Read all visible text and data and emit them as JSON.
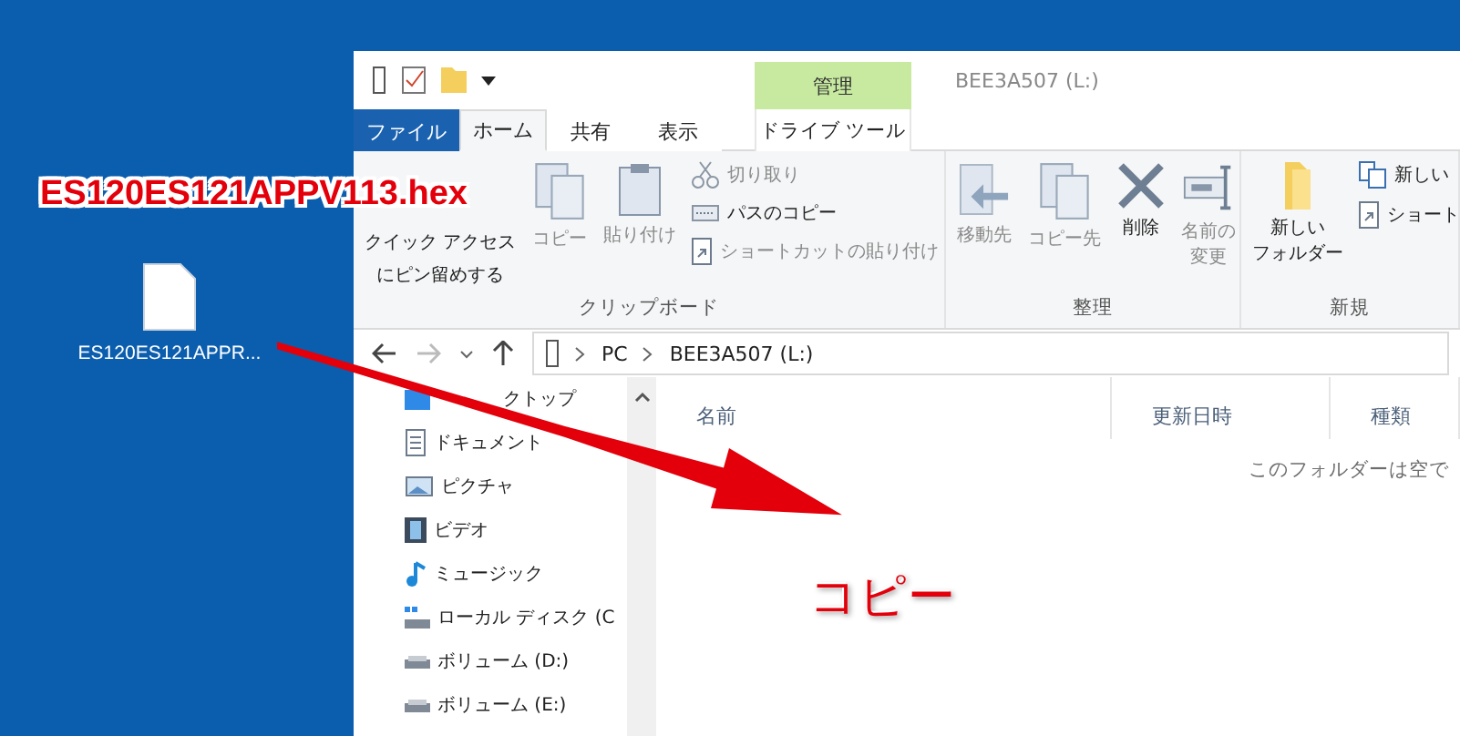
{
  "desktop": {
    "icons": [
      {
        "label": "ES120ES121APPR..."
      }
    ]
  },
  "explorer": {
    "context_tab": "管理",
    "title": "BEE3A507 (L:)",
    "tabs": [
      {
        "label": "ファイル",
        "kind": "file",
        "selected": false
      },
      {
        "label": "ホーム",
        "kind": "normal",
        "selected": true
      },
      {
        "label": "共有",
        "kind": "normal",
        "selected": false
      },
      {
        "label": "表示",
        "kind": "normal",
        "selected": false
      },
      {
        "label": "ドライブ ツール",
        "kind": "context",
        "selected": false
      }
    ],
    "ribbon": [
      {
        "label": "クリップボード",
        "large": [
          {
            "lines": [
              "クイック アクセス",
              "にピン留めする"
            ],
            "kind": "pin",
            "disabled": false
          },
          {
            "lines": [
              "コピー"
            ],
            "kind": "copy",
            "disabled": true
          },
          {
            "lines": [
              "貼り付け"
            ],
            "kind": "paste",
            "disabled": true
          }
        ],
        "small": [
          {
            "label": "切り取り",
            "kind": "cut",
            "disabled": true
          },
          {
            "label": "パスのコピー",
            "kind": "path",
            "disabled": false
          },
          {
            "label": "ショートカットの貼り付け",
            "kind": "shortcut",
            "disabled": true
          }
        ]
      },
      {
        "label": "整理",
        "large": [
          {
            "lines": [
              "移動先"
            ],
            "kind": "move",
            "disabled": true
          },
          {
            "lines": [
              "コピー先"
            ],
            "kind": "copy",
            "disabled": true
          },
          {
            "lines": [
              "削除"
            ],
            "kind": "delete",
            "disabled": false
          },
          {
            "lines": [
              "名前の",
              "変更"
            ],
            "kind": "rename",
            "disabled": true
          }
        ]
      },
      {
        "label": "新規",
        "large": [
          {
            "lines": [
              "新しい",
              "フォルダー"
            ],
            "kind": "folder",
            "disabled": false
          }
        ],
        "small": [
          {
            "label": "新しい",
            "kind": "newitem"
          },
          {
            "label": "ショート",
            "kind": "shortcut"
          }
        ]
      }
    ],
    "address": {
      "crumbs": [
        "PC",
        "BEE3A507 (L:)"
      ]
    },
    "nav_pane": {
      "items": [
        {
          "label": "クトップ",
          "kind": "desktop"
        },
        {
          "label": "ドキュメント",
          "kind": "document"
        },
        {
          "label": "ピクチャ",
          "kind": "picture"
        },
        {
          "label": "ビデオ",
          "kind": "video"
        },
        {
          "label": "ミュージック",
          "kind": "music"
        },
        {
          "label": "ローカル ディスク (C",
          "kind": "disk"
        },
        {
          "label": "ボリューム (D:)",
          "kind": "drive"
        },
        {
          "label": "ボリューム (E:)",
          "kind": "drive"
        }
      ]
    },
    "columns": [
      "名前",
      "更新日時",
      "種類"
    ],
    "empty_message": "このフォルダーは空で"
  },
  "annotations": [
    {
      "kind": "filename",
      "text": "ES120ES121APPV113.hex"
    },
    {
      "kind": "arrow"
    },
    {
      "kind": "caption",
      "text": "コピー"
    }
  ]
}
